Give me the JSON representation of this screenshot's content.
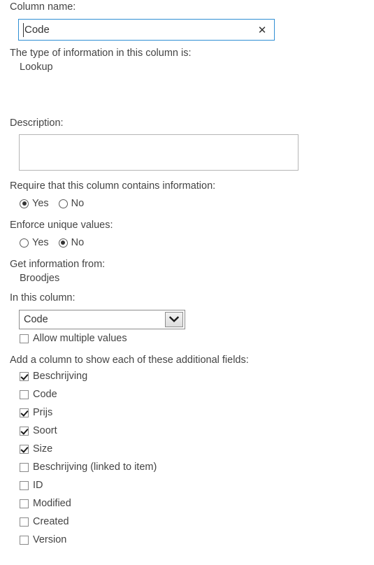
{
  "form": {
    "column_name": {
      "label": "Column name:",
      "value": "Code",
      "clear_icon": "close-icon",
      "clear_glyph": "✕"
    },
    "type_info": {
      "label": "The type of information in this column is:",
      "value": "Lookup"
    },
    "description": {
      "label": "Description:",
      "value": "",
      "placeholder": ""
    },
    "require_info": {
      "label": "Require that this column contains information:",
      "options": [
        {
          "label": "Yes",
          "selected": true
        },
        {
          "label": "No",
          "selected": false
        }
      ]
    },
    "enforce_unique": {
      "label": "Enforce unique values:",
      "options": [
        {
          "label": "Yes",
          "selected": false
        },
        {
          "label": "No",
          "selected": true
        }
      ]
    },
    "get_info_from": {
      "label": "Get information from:",
      "value": "Broodjes"
    },
    "in_this_column": {
      "label": "In this column:",
      "selected": "Code",
      "arrow_icon": "chevron-down-icon"
    },
    "allow_multiple": {
      "label": "Allow multiple values",
      "checked": false
    },
    "additional_fields": {
      "label": "Add a column to show each of these additional fields:",
      "items": [
        {
          "label": "Beschrijving",
          "checked": true
        },
        {
          "label": "Code",
          "checked": false
        },
        {
          "label": "Prijs",
          "checked": true
        },
        {
          "label": "Soort",
          "checked": true
        },
        {
          "label": "Size",
          "checked": true
        },
        {
          "label": "Beschrijving (linked to item)",
          "checked": false
        },
        {
          "label": "ID",
          "checked": false
        },
        {
          "label": "Modified",
          "checked": false
        },
        {
          "label": "Created",
          "checked": false
        },
        {
          "label": "Version",
          "checked": false
        }
      ]
    }
  },
  "colors": {
    "text": "#444444",
    "input_focus_border": "#2f8fd4",
    "box_border": "#b5b5b5",
    "control_border": "#8d8d8d"
  }
}
